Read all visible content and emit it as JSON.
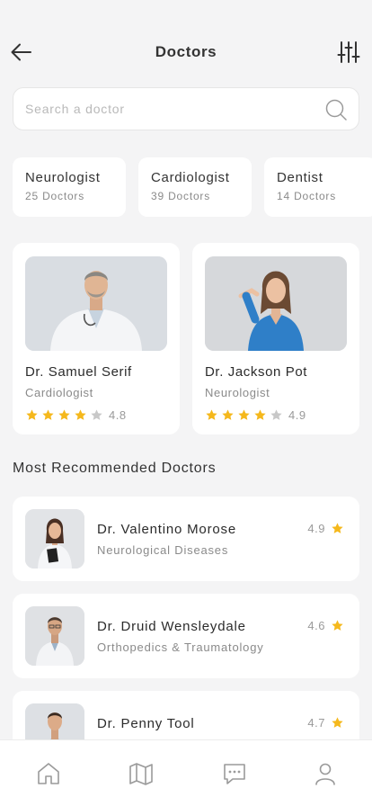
{
  "header": {
    "title": "Doctors"
  },
  "search": {
    "placeholder": "Search a doctor",
    "value": ""
  },
  "categories": [
    {
      "name": "Neurologist",
      "count": "25 Doctors"
    },
    {
      "name": "Cardiologist",
      "count": "39 Doctors"
    },
    {
      "name": "Dentist",
      "count": "14 Doctors"
    }
  ],
  "featured": [
    {
      "name": "Dr. Samuel Serif",
      "specialty": "Cardiologist",
      "rating": "4.8",
      "stars": 4
    },
    {
      "name": "Dr. Jackson Pot",
      "specialty": "Neurologist",
      "rating": "4.9",
      "stars": 4
    }
  ],
  "recommended": {
    "title": "Most Recommended Doctors",
    "items": [
      {
        "name": "Dr. Valentino Morose",
        "specialty": "Neurological Diseases",
        "rating": "4.9"
      },
      {
        "name": "Dr. Druid Wensleydale",
        "specialty": "Orthopedics & Traumatology",
        "rating": "4.6"
      },
      {
        "name": "Dr. Penny Tool",
        "specialty": "",
        "rating": "4.7"
      }
    ]
  },
  "colors": {
    "star_filled": "#f5b81c",
    "star_empty": "#c8c8c8",
    "background": "#f4f4f5",
    "card": "#ffffff"
  },
  "icons": {
    "back": "arrow-left-icon",
    "filter": "sliders-icon",
    "search": "search-icon",
    "nav": [
      "home-icon",
      "map-icon",
      "chat-icon",
      "user-icon"
    ]
  }
}
